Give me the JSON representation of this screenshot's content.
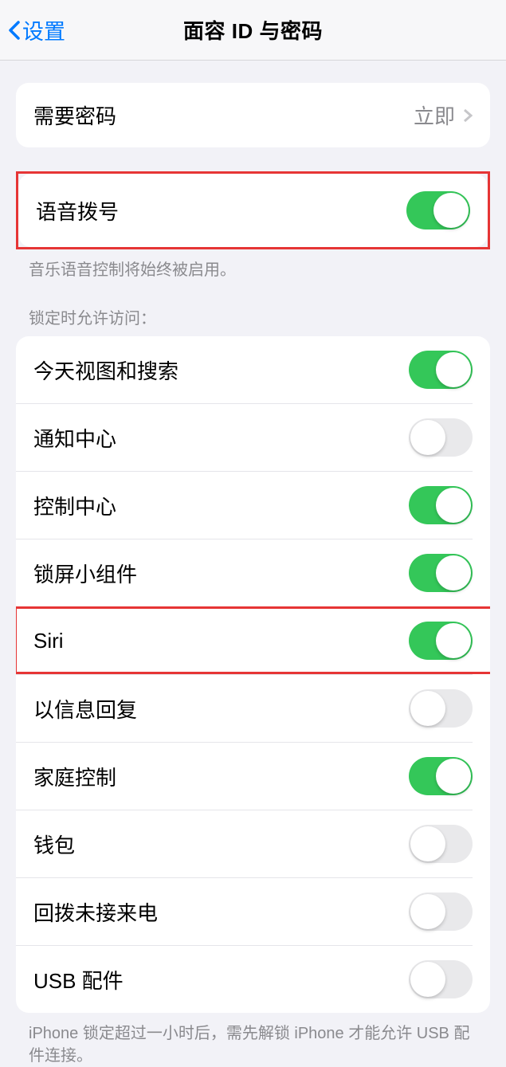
{
  "nav": {
    "back_label": "设置",
    "title": "面容 ID 与密码"
  },
  "require_passcode": {
    "label": "需要密码",
    "value": "立即"
  },
  "voice_dial": {
    "label": "语音拨号",
    "on": true,
    "footer": "音乐语音控制将始终被启用。"
  },
  "locked_header": "锁定时允许访问：",
  "locked_items": [
    {
      "label": "今天视图和搜索",
      "on": true
    },
    {
      "label": "通知中心",
      "on": false
    },
    {
      "label": "控制中心",
      "on": true
    },
    {
      "label": "锁屏小组件",
      "on": true
    },
    {
      "label": "Siri",
      "on": true,
      "highlighted": true
    },
    {
      "label": "以信息回复",
      "on": false
    },
    {
      "label": "家庭控制",
      "on": true
    },
    {
      "label": "钱包",
      "on": false
    },
    {
      "label": "回拨未接来电",
      "on": false
    },
    {
      "label": "USB 配件",
      "on": false
    }
  ],
  "usb_footer": "iPhone 锁定超过一小时后，需先解锁 iPhone 才能允许 USB 配件连接。"
}
